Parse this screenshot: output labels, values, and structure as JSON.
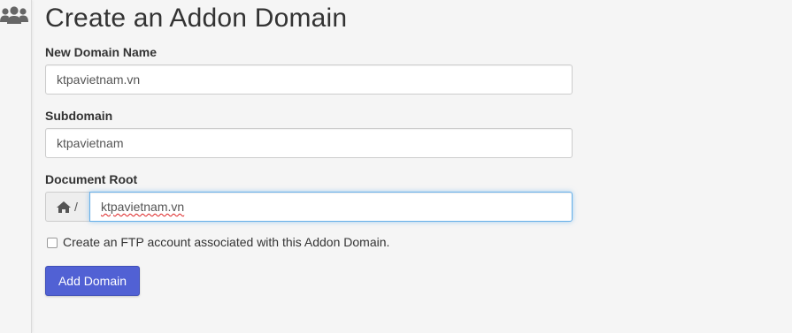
{
  "sidebar": {
    "icon": "users-icon"
  },
  "page": {
    "title": "Create an Addon Domain"
  },
  "form": {
    "new_domain": {
      "label": "New Domain Name",
      "value": "ktpavietnam.vn"
    },
    "subdomain": {
      "label": "Subdomain",
      "value": "ktpavietnam"
    },
    "document_root": {
      "label": "Document Root",
      "prefix_icon": "home-icon",
      "prefix_text": "/",
      "value": "ktpavietnam.vn"
    },
    "ftp": {
      "label": "Create an FTP account associated with this Addon Domain.",
      "checked": false
    },
    "submit_label": "Add Domain"
  },
  "colors": {
    "primary_button": "#5161d4",
    "focus_border": "#66afe9",
    "background": "#f5f5f5"
  }
}
